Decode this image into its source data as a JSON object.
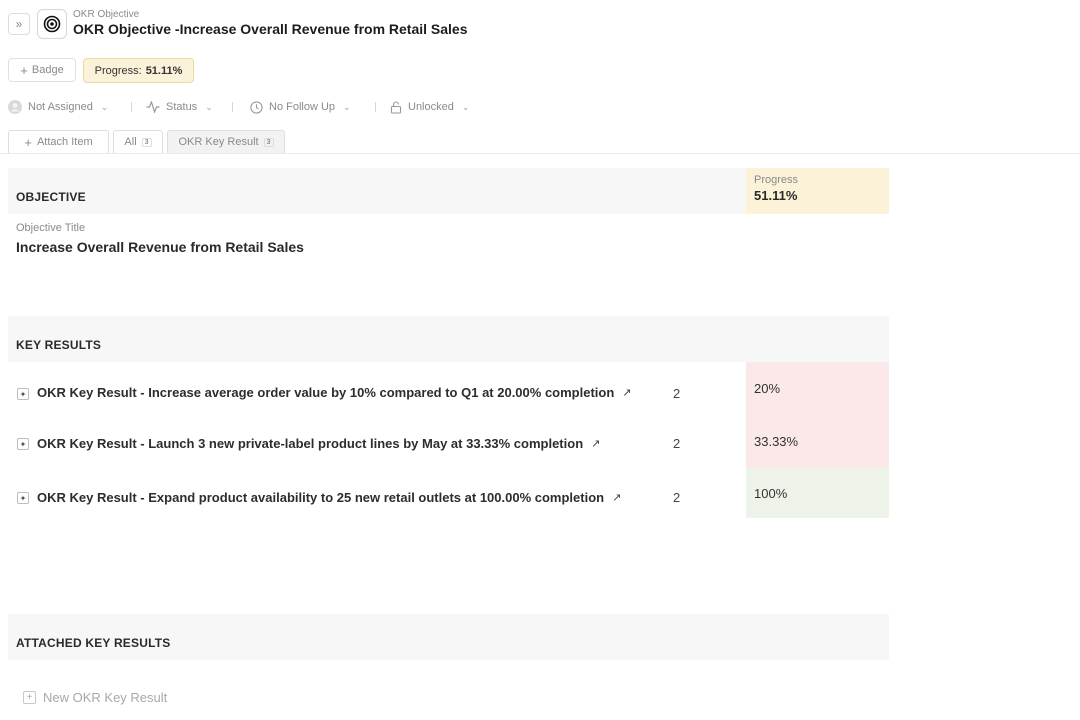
{
  "header": {
    "eyebrow": "OKR Objective",
    "title": "OKR Objective -Increase Overall Revenue from Retail Sales"
  },
  "badge_row": {
    "badge_label": "Badge",
    "progress_label": "Progress:",
    "progress_value": "51.11%"
  },
  "properties": {
    "assignee": "Not Assigned",
    "status": "Status",
    "follow_up": "No Follow Up",
    "lock": "Unlocked"
  },
  "tabs": {
    "attach": "Attach Item",
    "items": [
      {
        "label": "All",
        "count": "3"
      },
      {
        "label": "OKR Key Result",
        "count": "3"
      }
    ]
  },
  "objective": {
    "section_label": "OBJECTIVE",
    "progress_label": "Progress",
    "progress_value": "51.11%",
    "field_label": "Objective Title",
    "field_value": "Increase Overall Revenue from Retail Sales"
  },
  "key_results": {
    "section_label": "KEY RESULTS",
    "rows": [
      {
        "title": "OKR Key Result - Increase average order value by 10% compared to Q1 at 20.00% completion",
        "count": "2",
        "progress": "20%",
        "color": "#fbe8e8"
      },
      {
        "title": "OKR Key Result - Launch 3 new private-label product lines by May at 33.33% completion",
        "count": "2",
        "progress": "33.33%",
        "color": "#fbe8e8"
      },
      {
        "title": "OKR Key Result - Expand product availability to 25 new retail outlets at 100.00% completion",
        "count": "2",
        "progress": "100%",
        "color": "#eef3ea"
      }
    ]
  },
  "attached": {
    "section_label": "ATTACHED KEY RESULTS",
    "new_label": "New OKR Key Result"
  },
  "colors": {
    "progress_highlight": "#fbf2d8",
    "low_progress": "#fbe8e8",
    "complete_progress": "#eef3ea"
  },
  "icons": [
    "double-chevron-right-icon",
    "target-icon",
    "plus-icon",
    "user-icon",
    "chevron-down-icon",
    "activity-icon",
    "clock-icon",
    "lock-icon",
    "key-result-icon",
    "arrow-up-right-icon",
    "plus-square-icon"
  ]
}
